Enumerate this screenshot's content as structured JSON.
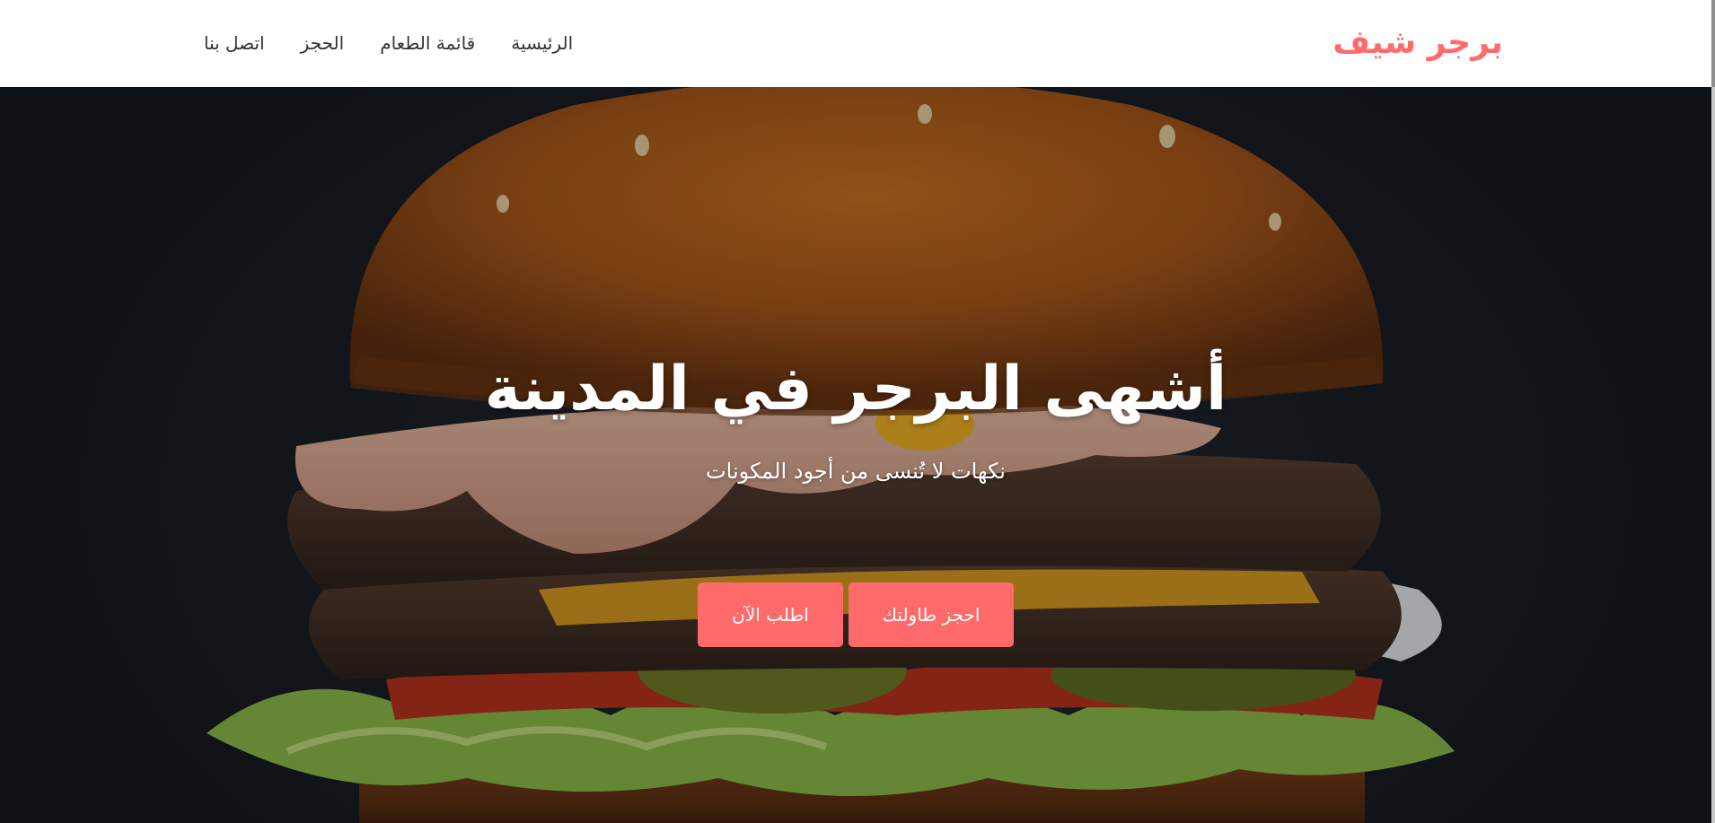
{
  "header": {
    "brand": "برجر شيف",
    "nav": [
      {
        "label": "الرئيسية"
      },
      {
        "label": "قائمة الطعام"
      },
      {
        "label": "الحجز"
      },
      {
        "label": "اتصل بنا"
      }
    ]
  },
  "hero": {
    "title": "أشهى البرجر في المدينة",
    "subtitle": "نكهات لا تُنسى من أجود المكونات",
    "buttons": {
      "reserve": "احجز طاولتك",
      "order": "اطلب الآن"
    }
  },
  "colors": {
    "accent": "#ff6b6b",
    "navbar_bg": "#ffffff",
    "nav_text": "#333333",
    "hero_text": "#ffffff",
    "hero_bg": "#1c2026"
  },
  "icons": {
    "hero_image": "burger-photo"
  }
}
